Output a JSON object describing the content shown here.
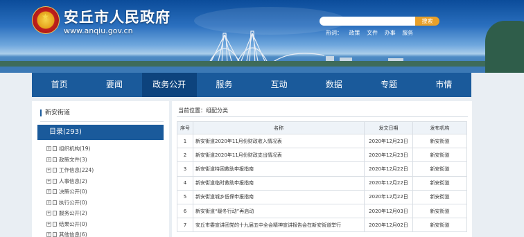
{
  "header": {
    "site_title": "安丘市人民政府",
    "site_url": "www.anqiu.gov.cn",
    "search_button": "搜索",
    "hot_label": "热词：",
    "hot_words": [
      "政策",
      "文件",
      "办事",
      "服务"
    ]
  },
  "nav": [
    {
      "label": "首页"
    },
    {
      "label": "要闻"
    },
    {
      "label": "政务公开",
      "active": true
    },
    {
      "label": "服务"
    },
    {
      "label": "互动"
    },
    {
      "label": "数据"
    },
    {
      "label": "专题"
    },
    {
      "label": "市情"
    }
  ],
  "sidebar": {
    "title": "新安街道",
    "directory_label": "目录(293)",
    "items": [
      {
        "label": "组织机构(19)"
      },
      {
        "label": "政策文件(3)"
      },
      {
        "label": "工作信息(224)"
      },
      {
        "label": "人事信息(2)"
      },
      {
        "label": "决策公开(0)"
      },
      {
        "label": "执行公开(0)"
      },
      {
        "label": "服务公开(2)"
      },
      {
        "label": "结果公开(0)"
      },
      {
        "label": "其他信息(6)"
      }
    ]
  },
  "main": {
    "breadcrumb": "当前位置：组配分类",
    "columns": {
      "no": "序号",
      "title": "名称",
      "date": "发文日期",
      "org": "发布机构"
    },
    "rows": [
      {
        "no": "1",
        "title": "新安街道2020年11月份财政收入情况表",
        "date": "2020年12月23日",
        "org": "新安街道"
      },
      {
        "no": "2",
        "title": "新安街道2020年11月份财政支出情况表",
        "date": "2020年12月23日",
        "org": "新安街道"
      },
      {
        "no": "3",
        "title": "新安街道特困救助申报指南",
        "date": "2020年12月22日",
        "org": "新安街道"
      },
      {
        "no": "4",
        "title": "新安街道临时救助申报指南",
        "date": "2020年12月22日",
        "org": "新安街道"
      },
      {
        "no": "5",
        "title": "新安街道城乡低保申报指南",
        "date": "2020年12月22日",
        "org": "新安街道"
      },
      {
        "no": "6",
        "title": "新安街道“暖冬行动”再启动",
        "date": "2020年12月03日",
        "org": "新安街道"
      },
      {
        "no": "7",
        "title": "安丘市委宣讲团党的十九届五中全会精神宣讲报告会在新安街道举行",
        "date": "2020年12月02日",
        "org": "新安街道"
      }
    ]
  },
  "colors": {
    "nav_bg": "#1a5a9b",
    "nav_active": "#0d437d",
    "search_button": "#e8a02a"
  }
}
